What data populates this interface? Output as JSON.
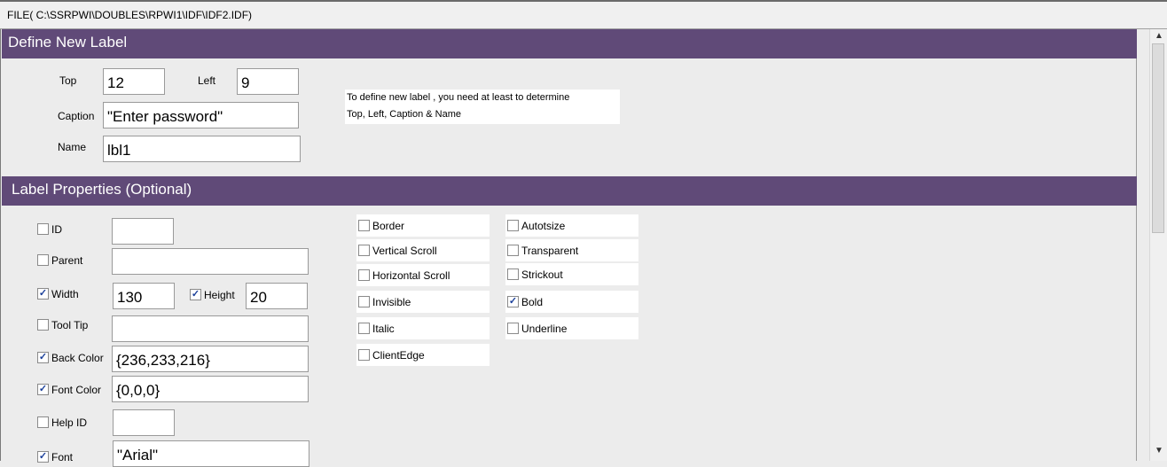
{
  "window": {
    "title": "FILE( C:\\SSRPWI\\DOUBLES\\RPWI1\\IDF\\IDF2.IDF)"
  },
  "define_section": {
    "header": "Define New  Label",
    "top": {
      "label": "Top",
      "value": "12"
    },
    "left": {
      "label": "Left",
      "value": "9"
    },
    "caption": {
      "label": "Caption",
      "value": "\"Enter password\""
    },
    "name": {
      "label": "Name",
      "value": "lbl1"
    },
    "info_line1": "To define new label , you need at least to determine",
    "info_line2": "Top, Left, Caption & Name"
  },
  "properties_section": {
    "header": "Label Properties (Optional)",
    "id": {
      "label": "ID",
      "checked": false,
      "value": ""
    },
    "parent": {
      "label": "Parent",
      "checked": false,
      "value": ""
    },
    "width": {
      "label": "Width",
      "checked": true,
      "value": "130"
    },
    "height": {
      "label": "Height",
      "checked": true,
      "value": "20"
    },
    "tooltip": {
      "label": "Tool Tip",
      "checked": false,
      "value": ""
    },
    "back_color": {
      "label": "Back Color",
      "checked": true,
      "value": "{236,233,216}"
    },
    "font_color": {
      "label": "Font Color",
      "checked": true,
      "value": "{0,0,0}"
    },
    "help_id": {
      "label": "Help ID",
      "checked": false,
      "value": ""
    },
    "font": {
      "label": "Font",
      "checked": true,
      "value": "\"Arial\""
    },
    "options": [
      {
        "label": "Border",
        "checked": false
      },
      {
        "label": "Autotsize",
        "checked": false
      },
      {
        "label": "Vertical Scroll",
        "checked": false
      },
      {
        "label": "Transparent",
        "checked": false
      },
      {
        "label": "Horizontal Scroll",
        "checked": false
      },
      {
        "label": "Strickout",
        "checked": false
      },
      {
        "label": "Invisible",
        "checked": false
      },
      {
        "label": "Bold",
        "checked": true
      },
      {
        "label": "Italic",
        "checked": false
      },
      {
        "label": "Underline",
        "checked": false
      },
      {
        "label": "ClientEdge",
        "checked": false
      }
    ]
  },
  "icons": {
    "check": "✓",
    "scroll_up": "▲",
    "scroll_down": "▼"
  },
  "colors": {
    "header_bg": "#604a78",
    "panel_bg": "#ececec",
    "check_color": "#1a3f9a"
  }
}
